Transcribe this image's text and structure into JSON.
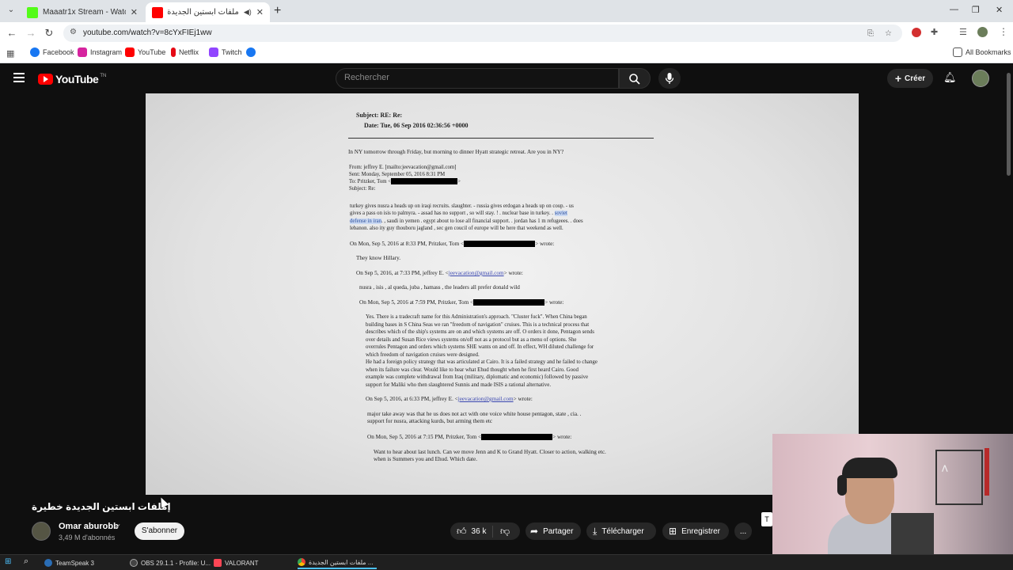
{
  "browser": {
    "tabs": [
      {
        "title": "Maaatr1x Stream - Watch Live o",
        "active": false,
        "favicon_color": "#53fc18"
      },
      {
        "title": "ملفات ابستين الجديدة خطيرة",
        "active": true,
        "favicon_color": "#ff0000"
      }
    ],
    "url": "youtube.com/watch?v=8cYxFIEj1ww",
    "bookmarks": [
      {
        "label": "Facebook",
        "color": "#1877f2"
      },
      {
        "label": "Instagram",
        "color": "#d6249f"
      },
      {
        "label": "YouTube",
        "color": "#ff0000"
      },
      {
        "label": "Netflix",
        "color": "#e50914"
      },
      {
        "label": "Twitch",
        "color": "#9146ff"
      },
      {
        "label": "",
        "color": "#1877f2"
      }
    ],
    "all_bookmarks": "All Bookmarks"
  },
  "youtube": {
    "logo_text": "YouTube",
    "logo_suffix": "TN",
    "search_placeholder": "Rechercher",
    "create_label": "Créer"
  },
  "document": {
    "subject": "Subject: RE: Re:",
    "date": "Date: Tue, 06 Sep 2016 02:36:56 +0000",
    "line_ny": "In NY tomorrow through Friday, but morning to dinner Hyatt strategic retreat.  Are you in NY?",
    "from": "From: jeffrey E. [mailto:jeevacation@gmail.com]",
    "sent": "Sent: Monday, September 05, 2016 8:31 PM",
    "to": "To: Pritzker, Tom <",
    "subj2": "Subject: Re:",
    "p1a": "turkey gives nusra a heads up on iraqi recruits.    slaughter. -  russia gives erdogan a heads up on coup.  -  us",
    "p1b": "gives a pass on isis to palmyra. -    assad has no support , so will stay. ! .   nuclear base in turkey.  .",
    "p1b_hl": "soviet",
    "p1c_hl": "defense in iran",
    "p1c": ". , saudi in yemen  . egypt  about to lose all financial support. .  jordan has 1 m refugeees.  . does",
    "p1d": "lebanon.   also  ity guy thouboru jagland ,  sec gen coucil of europe will be here that weekend as well.",
    "w1": "On Mon, Sep 5, 2016 at 8:33 PM, Pritzker, Tom <",
    "w_end": "> wrote:",
    "hillary": "They know Hillary.",
    "w2a": "On Sep 5, 2016, at 7:33 PM, jeffrey E. <",
    "email": "jeevacation@gmail.com",
    "w2b": "> wrote:",
    "nusra": "nusra , isis , al queda, juba , hamass ,  the leaders all prefer donald  wild",
    "w3": "On Mon, Sep 5, 2016 at 7:59 PM, Pritzker, Tom <",
    "yes": [
      "Yes.  There is a tradecraft name for this Administration's approach.  \"Cluster fuck\".  When China began",
      "building bases in S China Seas we ran \"freedom of navigation\" cruises.  This is a technical process that",
      "describes which of the ship's systems are on and which systems are off.  O orders it done, Pentagon sends",
      "over details and Susan Rice views systems on/off not as a protocol but as a menu of options.  She",
      "overrules Pentagon and orders which systems SHE wants on and off.  In effect, WH diluted challenge for",
      "which freedom of navigation cruises were designed.",
      "He had a foreign policy strategy that was articulated at Cairo.  It is a failed strategy and he failed to change",
      "when its failure was clear.  Would like to hear what Ehud thought when he first heard Cairo.  Good",
      "example was complete withdrawal from Iraq (military, diplomatic and economic) followed by passive",
      "support for Maliki who then slaughtered Sunnis and made ISIS a rational alternative."
    ],
    "w4a": "On Sep 5, 2016, at 6:33 PM, jeffrey E. <",
    "w4b": "> wrote:",
    "major": [
      "major take away was  that he us does not act with one voice    white house pentagon,  state , cia.  .",
      "support for nusra, attacking kurds, but arming them  etc"
    ],
    "w5": "On Mon, Sep 5, 2016 at 7:15 PM, Pritzker, Tom <",
    "lunch": [
      "Want to hear about last lunch.  Can we move Jenn and K to Grand Hyatt. Closer to action, walking etc.",
      "when is Summers you and Ehud. Which date."
    ]
  },
  "video_info": {
    "title": "إملفات ابستين الجديدة خطيرة",
    "channel": "Omar aburobb",
    "subscribers": "3,49 M d'abonnés",
    "subscribe_label": "S'abonner",
    "likes": "36 k",
    "share_label": "Partager",
    "download_label": "Télécharger",
    "save_label": "Enregistrer",
    "more_label": "...",
    "overlay_letter": "T"
  },
  "taskbar": [
    {
      "label": "TeamSpeak 3",
      "color": "#2a6db5",
      "active": false
    },
    {
      "label": "OBS 29.1.1 - Profile: U...",
      "color": "#444",
      "active": false
    },
    {
      "label": "VALORANT",
      "color": "#ff4655",
      "active": false
    },
    {
      "label": "ملفات ابستين الجديدة ...",
      "color": "#fbbc05",
      "active": true
    }
  ]
}
